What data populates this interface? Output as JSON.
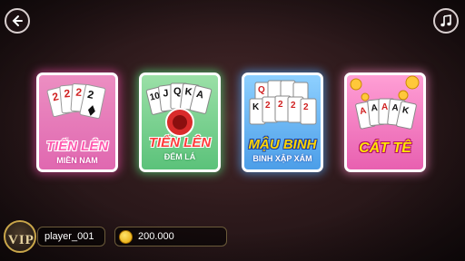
{
  "header": {
    "back_icon": "arrow-left-icon",
    "music_icon": "music-note-icon"
  },
  "games": [
    {
      "id": "tien-len-mien-nam",
      "title": "TIẾN LÊN",
      "subtitle": "MIỀN NAM",
      "accent": "#e068b0",
      "cards": [
        "2",
        "2",
        "2",
        "2"
      ]
    },
    {
      "id": "tien-len-dem-la",
      "title": "TIẾN LÊN",
      "subtitle": "ĐẾM LÁ",
      "accent": "#5bc27a",
      "cards": [
        "10",
        "J",
        "Q",
        "K",
        "A"
      ]
    },
    {
      "id": "mau-binh",
      "title": "MẬU BINH",
      "subtitle": "BINH XẬP XÁM",
      "accent": "#4c9ee8",
      "cards": [
        "Q",
        "K",
        "2",
        "2",
        "2",
        "2"
      ]
    },
    {
      "id": "cat-te",
      "title": "CÁT TÊ",
      "subtitle": "",
      "accent": "#e860b0",
      "cards": [
        "A",
        "A",
        "A",
        "A",
        "K"
      ]
    }
  ],
  "player": {
    "vip_label": "VIP",
    "name": "player_001",
    "coins": "200.000"
  }
}
